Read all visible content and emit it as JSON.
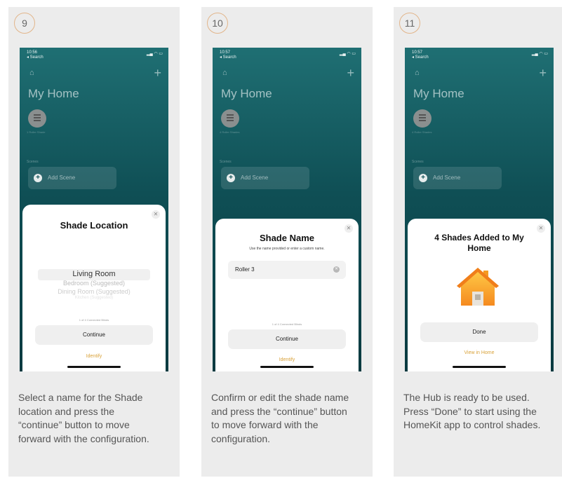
{
  "panels": [
    {
      "step": "9",
      "phone": {
        "time": "10:56",
        "back": "◂ Search",
        "home_title": "My Home",
        "scenes_label": "Scenes",
        "add_scene": "Add Scene",
        "accessory_label": "1 Roller Shade"
      },
      "sheet": {
        "title": "Shade Location",
        "options": [
          "Living Room",
          "Bedroom (Suggested)",
          "Dining Room (Suggested)",
          "Kitchen (Suggested)"
        ],
        "count": "1 of 4 Connected Blinds",
        "button": "Continue",
        "link": "Identify"
      },
      "description": "Select a name for the Shade location and press the “continue” button to move forward with the configuration."
    },
    {
      "step": "10",
      "phone": {
        "time": "10:57",
        "back": "◂ Search",
        "home_title": "My Home",
        "scenes_label": "Scenes",
        "add_scene": "Add Scene",
        "accessory_label": "4 Roller Shades"
      },
      "sheet": {
        "title": "Shade Name",
        "subtitle": "Use the name provided or enter a custom name.",
        "field_value": "Roller 3",
        "count": "1 of 4 Connected Blinds",
        "button": "Continue",
        "link": "Identify"
      },
      "description": "Confirm or edit the shade name and press the “continue” button to move forward with the configuration."
    },
    {
      "step": "11",
      "phone": {
        "time": "10:57",
        "back": "◂ Search",
        "home_title": "My Home",
        "scenes_label": "Scenes",
        "add_scene": "Add Scene",
        "accessory_label": "4 Roller Shades"
      },
      "sheet": {
        "title": "4 Shades Added to My Home",
        "button": "Done",
        "link": "View in Home"
      },
      "description": "The Hub is ready to be used. Press “Done” to start using the HomeKit app to control shades."
    }
  ],
  "colors": {
    "step_ring": "#e2b58a",
    "accent_link": "#d9a23a",
    "phone_bg": "#0f4f55",
    "house_orange": "#f5a623"
  },
  "icons": {
    "home": "house-icon",
    "add": "plus-icon",
    "close": "close-icon",
    "clear": "clear-field-icon"
  }
}
